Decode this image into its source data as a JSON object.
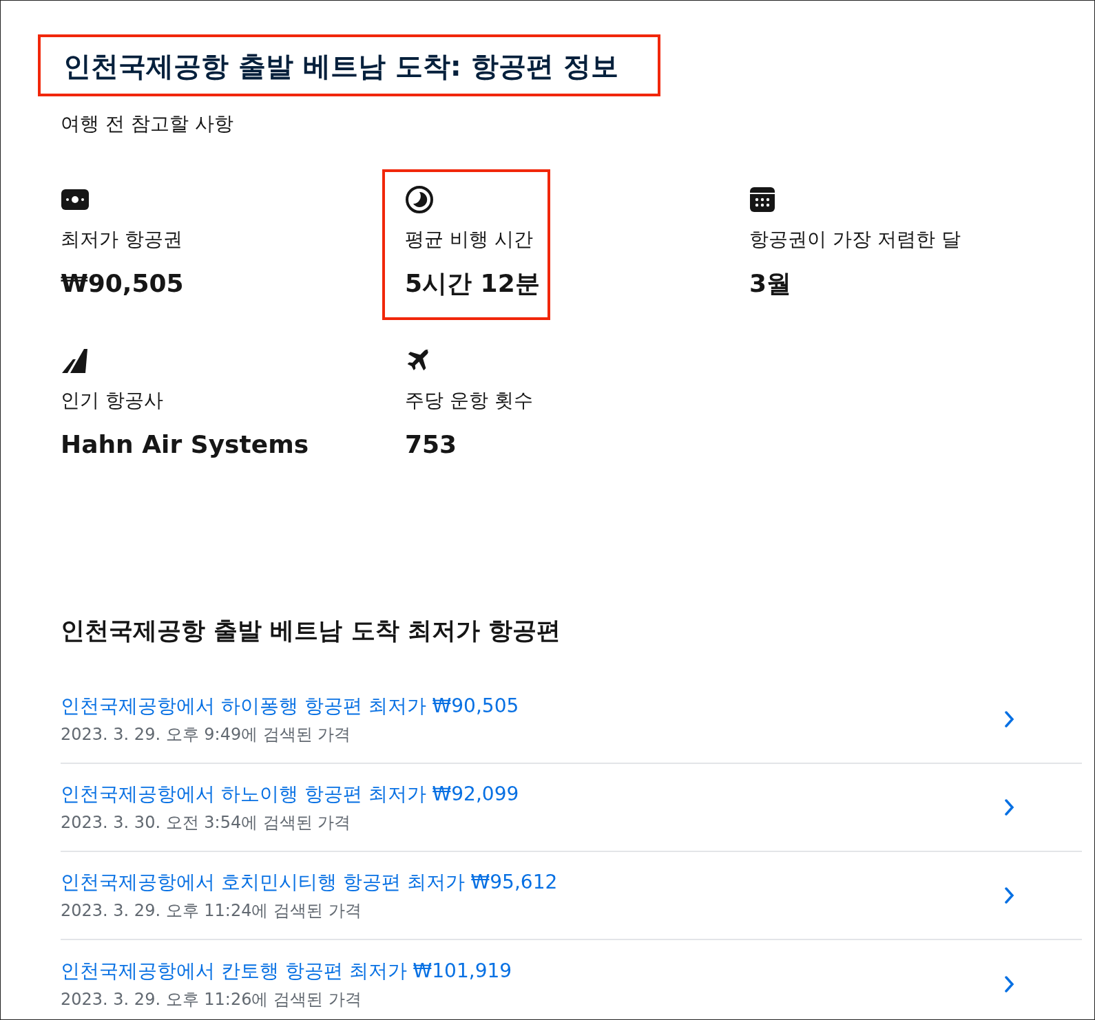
{
  "title": {
    "text": "인천국제공항 출발 베트남 도착: 항공편 정보",
    "highlighted": true
  },
  "subtitle": "여행 전 참고할 사항",
  "stats": [
    {
      "kind": "price",
      "label": "최저가 항공권",
      "value": "₩90,505",
      "highlighted": false
    },
    {
      "kind": "duration",
      "label": "평균 비행 시간",
      "value": "5시간 12분",
      "highlighted": true
    },
    {
      "kind": "month",
      "label": "항공권이 가장 저렴한 달",
      "value": "3월",
      "highlighted": false
    },
    {
      "kind": "airline",
      "label": "인기 항공사",
      "value": "Hahn Air Systems",
      "highlighted": false
    },
    {
      "kind": "frequency",
      "label": "주당 운항 횟수",
      "value": "753",
      "highlighted": false
    }
  ],
  "deals_heading": "인천국제공항 출발 베트남 도착 최저가 항공편",
  "deals": [
    {
      "title": "인천국제공항에서 하이퐁행 항공편 최저가 ₩90,505",
      "searched": "2023. 3. 29. 오후 9:49에 검색된 가격"
    },
    {
      "title": "인천국제공항에서 하노이행 항공편 최저가 ₩92,099",
      "searched": "2023. 3. 30. 오전 3:54에 검색된 가격"
    },
    {
      "title": "인천국제공항에서 호치민시티행 항공편 최저가 ₩95,612",
      "searched": "2023. 3. 29. 오후 11:24에 검색된 가격"
    },
    {
      "title": "인천국제공항에서 칸토행 항공편 최저가 ₩101,919",
      "searched": "2023. 3. 29. 오후 11:26에 검색된 가격"
    }
  ]
}
